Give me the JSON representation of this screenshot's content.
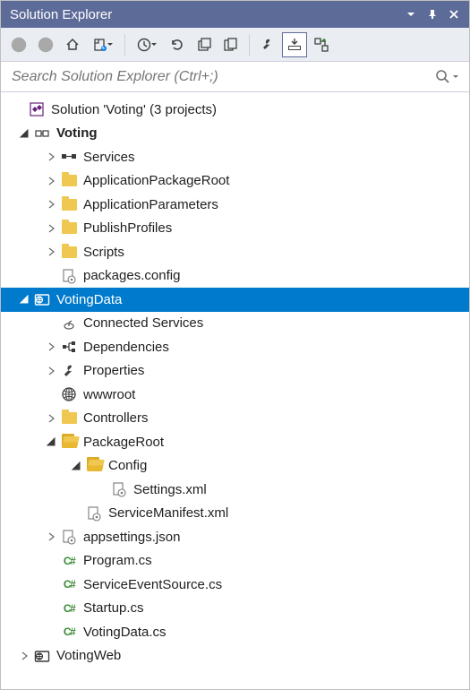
{
  "title": "Solution Explorer",
  "search": {
    "placeholder": "Search Solution Explorer (Ctrl+;)"
  },
  "solution": {
    "label": "Solution 'Voting' (3 projects)",
    "projects": {
      "voting": {
        "label": "Voting",
        "items": {
          "services": "Services",
          "app_pkg_root": "ApplicationPackageRoot",
          "app_params": "ApplicationParameters",
          "publish_profiles": "PublishProfiles",
          "scripts": "Scripts",
          "packages_config": "packages.config"
        }
      },
      "votingdata": {
        "label": "VotingData",
        "items": {
          "connected_services": "Connected Services",
          "dependencies": "Dependencies",
          "properties": "Properties",
          "wwwroot": "wwwroot",
          "controllers": "Controllers",
          "package_root": {
            "label": "PackageRoot",
            "config": {
              "label": "Config",
              "settings_xml": "Settings.xml"
            },
            "service_manifest": "ServiceManifest.xml"
          },
          "appsettings": "appsettings.json",
          "program_cs": "Program.cs",
          "service_event_source_cs": "ServiceEventSource.cs",
          "startup_cs": "Startup.cs",
          "votingdata_cs": "VotingData.cs"
        }
      },
      "votingweb": {
        "label": "VotingWeb"
      }
    }
  }
}
